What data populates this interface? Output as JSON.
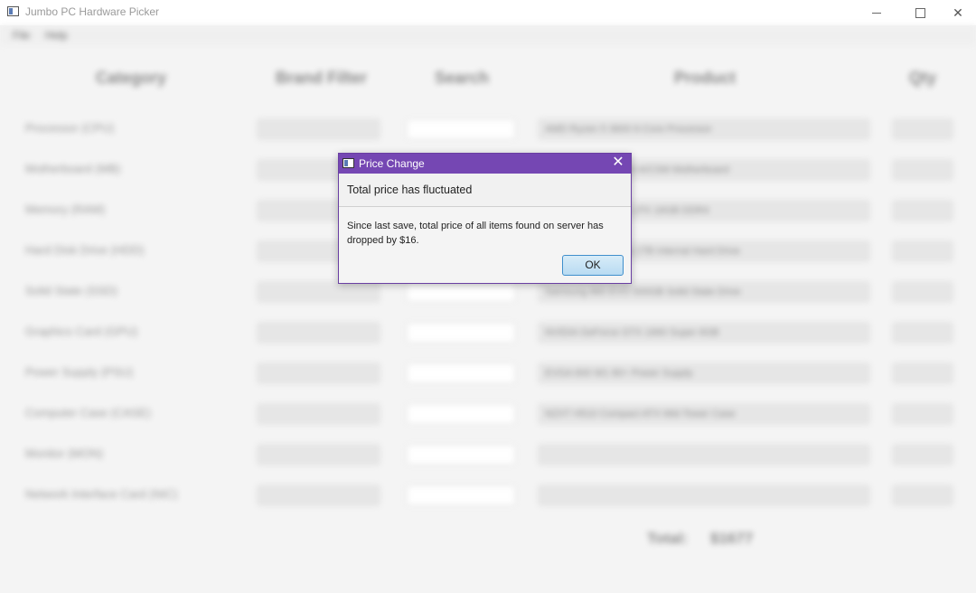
{
  "window": {
    "title": "Jumbo PC Hardware Picker"
  },
  "menu": [
    "File",
    "Help"
  ],
  "columns": {
    "category": "Category",
    "brand": "Brand Filter",
    "search": "Search",
    "product": "Product",
    "qty": "Qty"
  },
  "rows": [
    {
      "category": "Processor (CPU)",
      "product": "AMD Ryzen 5 3600 6-Core Processor"
    },
    {
      "category": "Motherboard (MB)",
      "product": "ASUS Prime B450M-A/CSM Motherboard"
    },
    {
      "category": "Memory (RAM)",
      "product": "Corsair Vengeance LPX 16GB DDR4"
    },
    {
      "category": "Hard Disk Drive (HDD)",
      "product": "Seagate BarraCuda 1TB Internal Hard Drive"
    },
    {
      "category": "Solid State (SSD)",
      "product": "Samsung 860 EVO 500GB Solid State Drive"
    },
    {
      "category": "Graphics Card (GPU)",
      "product": "NVIDIA GeForce GTX 1660 Super 6GB"
    },
    {
      "category": "Power Supply (PSU)",
      "product": "EVGA 600 W1 80+ Power Supply"
    },
    {
      "category": "Computer Case (CASE)",
      "product": "NZXT H510 Compact ATX Mid-Tower Case"
    },
    {
      "category": "Monitor (MON)",
      "product": ""
    },
    {
      "category": "Network Interface Card (NIC)",
      "product": ""
    }
  ],
  "total": {
    "label": "Total:",
    "value": "$1677"
  },
  "dialog": {
    "title": "Price Change",
    "header": "Total price has fluctuated",
    "body": "Since last save, total price of all items found on server has dropped by $16.",
    "ok_label": "OK",
    "close_glyph": "✕"
  },
  "colors": {
    "dialog_titlebar": "#7547b3",
    "ok_border": "#3f8fcc"
  }
}
